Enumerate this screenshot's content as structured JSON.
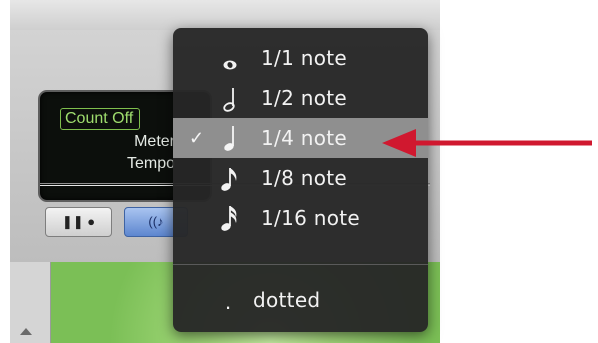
{
  "display": {
    "count_off": "Count Off",
    "meter": "Meter",
    "tempo": "Tempo"
  },
  "menu": {
    "items": [
      {
        "label": "1/1 note",
        "icon": "whole-note-icon",
        "selected": false
      },
      {
        "label": "1/2 note",
        "icon": "half-note-icon",
        "selected": false
      },
      {
        "label": "1/4 note",
        "icon": "quarter-note-icon",
        "selected": true,
        "check": "✓"
      },
      {
        "label": "1/8 note",
        "icon": "eighth-note-icon",
        "selected": false
      },
      {
        "label": "1/16 note",
        "icon": "sixteenth-note-icon",
        "selected": false
      }
    ],
    "dotted": {
      "symbol": ".",
      "label": "dotted"
    }
  },
  "colors": {
    "menu_bg": "#262626",
    "selected_bg": "#8f8f8f",
    "arrow": "#d0182f",
    "lcd_green": "#9fdd6e"
  }
}
